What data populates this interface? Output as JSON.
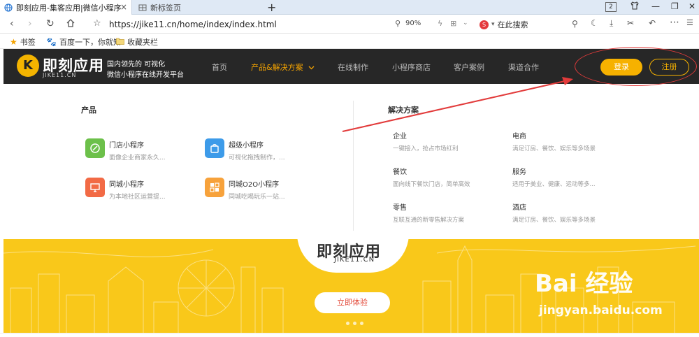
{
  "browser": {
    "tabs": [
      {
        "title": "即刻应用-集客应用|微信小程序工具",
        "active": true
      },
      {
        "title": "新标签页",
        "active": false
      }
    ],
    "new_tab": "+",
    "tab_count": "2",
    "url": "https://jike11.cn/home/index/index.html",
    "zoom": "90%",
    "search_placeholder": "在此搜索",
    "bookmarks": [
      {
        "label": "书签"
      },
      {
        "label": "百度一下，你就知"
      },
      {
        "label": "收藏夹栏"
      }
    ]
  },
  "site": {
    "logo": {
      "mark": "K",
      "name": "即刻应用",
      "domain": "JIKE11.CN"
    },
    "slogan_line1": "国内领先的 可视化",
    "slogan_line2": "微信小程序在线开发平台",
    "nav": [
      {
        "label": "首页",
        "active": false
      },
      {
        "label": "产品&解决方案",
        "active": true
      },
      {
        "label": "在线制作",
        "active": false
      },
      {
        "label": "小程序商店",
        "active": false
      },
      {
        "label": "客户案例",
        "active": false
      },
      {
        "label": "渠道合作",
        "active": false
      }
    ],
    "login": "登录",
    "register": "注册"
  },
  "dropdown": {
    "products_title": "产品",
    "solutions_title": "解决方案",
    "products": [
      {
        "name": "门店小程序",
        "desc": "面像企业商家永久...",
        "color": "#6cc04a"
      },
      {
        "name": "超级小程序",
        "desc": "可视化拖拽制作，...",
        "color": "#3d9be9"
      },
      {
        "name": "同城小程序",
        "desc": "为本地社区运营提...",
        "color": "#f26a45"
      },
      {
        "name": "同城O2O小程序",
        "desc": "同城吃喝玩乐一站...",
        "color": "#f7a23b"
      }
    ],
    "solutions": [
      {
        "name": "企业",
        "desc": "一键接入，抢占市场红利"
      },
      {
        "name": "电商",
        "desc": "满足订房、餐饮、娱乐等多场景"
      },
      {
        "name": "餐饮",
        "desc": "面向线下餐饮门店，简单高效"
      },
      {
        "name": "服务",
        "desc": "适用于美业、健康、运动等多..."
      },
      {
        "name": "零售",
        "desc": "互联互通的新零售解决方案"
      },
      {
        "name": "酒店",
        "desc": "满足订房、餐饮、娱乐等多场景"
      }
    ]
  },
  "banner": {
    "title": "即刻应用",
    "subtitle": "JIKE11.CN",
    "cta": "立即体验",
    "watermark": "Bai 经验",
    "watermark_url": "jingyan.baidu.com"
  },
  "colors": {
    "header_bg": "#272727",
    "accent": "#f6b100",
    "banner_bg": "#f9c81a",
    "annotation_red": "#e23b3b"
  }
}
